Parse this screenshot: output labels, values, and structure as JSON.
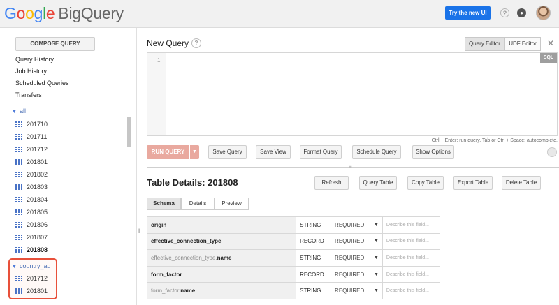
{
  "header": {
    "logo_letters": [
      "G",
      "o",
      "o",
      "g",
      "l",
      "e"
    ],
    "product": "BigQuery",
    "try_new_ui": "Try the new UI",
    "help_icon": "?",
    "notifications_icon": "bell-icon"
  },
  "sidebar": {
    "compose_label": "COMPOSE QUERY",
    "links": [
      "Query History",
      "Job History",
      "Scheduled Queries",
      "Transfers"
    ],
    "datasets": [
      {
        "name": "all",
        "tables": [
          "201710",
          "201711",
          "201712",
          "201801",
          "201802",
          "201803",
          "201804",
          "201805",
          "201806",
          "201807",
          "201808"
        ],
        "active": "201808"
      },
      {
        "name": "country_ad",
        "tables": [
          "201712",
          "201801"
        ]
      }
    ],
    "caret": "▼"
  },
  "editor": {
    "title": "New Query",
    "tabs": [
      "Query Editor",
      "UDF Editor"
    ],
    "close": "✕",
    "line_number": "1",
    "sql_badge": "SQL",
    "hint": "Ctrl + Enter: run query, Tab or Ctrl + Space: autocomplete.",
    "run_label": "RUN QUERY",
    "run_dropdown": "▼",
    "buttons": [
      "Save Query",
      "Save View",
      "Format Query",
      "Schedule Query",
      "Show Options"
    ]
  },
  "details": {
    "title": "Table Details: 201808",
    "buttons": [
      "Refresh",
      "Query Table",
      "Copy Table",
      "Export Table",
      "Delete Table"
    ],
    "subtabs": [
      "Schema",
      "Details",
      "Preview"
    ],
    "schema": [
      {
        "parent": "",
        "name": "origin",
        "type": "STRING",
        "mode": "REQUIRED"
      },
      {
        "parent": "",
        "name": "effective_connection_type",
        "type": "RECORD",
        "mode": "REQUIRED"
      },
      {
        "parent": "effective_connection_type.",
        "name": "name",
        "type": "STRING",
        "mode": "REQUIRED"
      },
      {
        "parent": "",
        "name": "form_factor",
        "type": "RECORD",
        "mode": "REQUIRED"
      },
      {
        "parent": "form_factor.",
        "name": "name",
        "type": "STRING",
        "mode": "REQUIRED"
      }
    ],
    "mode_dropdown": "▼",
    "description_placeholder": "Describe this field..."
  },
  "colors": {
    "accent": "#1a73e8",
    "run_button": "#e9a99f",
    "highlight": "#e8503a"
  }
}
